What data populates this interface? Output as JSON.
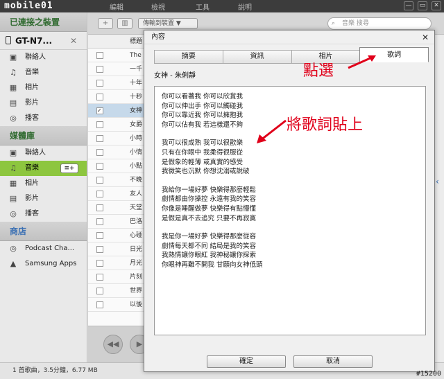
{
  "logo": "mobile01",
  "menu": [
    "編輯",
    "檢視",
    "工具",
    "說明"
  ],
  "window_controls": [
    "—",
    "▭",
    "✕"
  ],
  "sidebar": {
    "connected_header": "已連接之裝置",
    "device_name": "GT-N7...",
    "device_close": "✕",
    "device_items": [
      {
        "label": "聯絡人",
        "icon": "contacts-icon",
        "glyph": "▣"
      },
      {
        "label": "音樂",
        "icon": "music-icon",
        "glyph": "♫"
      },
      {
        "label": "相片",
        "icon": "photo-icon",
        "glyph": "▦"
      },
      {
        "label": "影片",
        "icon": "video-icon",
        "glyph": "▤"
      },
      {
        "label": "播客",
        "icon": "podcast-icon",
        "glyph": "◎"
      }
    ],
    "library_header": "媒體庫",
    "library_items": [
      {
        "label": "聯絡人",
        "icon": "contacts-icon",
        "glyph": "▣"
      },
      {
        "label": "音樂",
        "icon": "music-icon",
        "glyph": "♫"
      },
      {
        "label": "相片",
        "icon": "photo-icon",
        "glyph": "▦"
      },
      {
        "label": "影片",
        "icon": "video-icon",
        "glyph": "▤"
      },
      {
        "label": "播客",
        "icon": "podcast-icon",
        "glyph": "◎"
      }
    ],
    "add_button": "≡+",
    "shop_header": "商店",
    "shop_items": [
      {
        "label": "Podcast Cha...",
        "icon": "podcast-icon",
        "glyph": "◎"
      },
      {
        "label": "Samsung Apps",
        "icon": "apps-icon",
        "glyph": "▲"
      }
    ]
  },
  "status_bar": "1 首歌曲，3.5分鐘，6.77 MB",
  "toolbar": {
    "add": "+",
    "delete": "▥",
    "transfer_label": "傳輸到裝置 ▼",
    "search_placeholder": "音樂 搜尋"
  },
  "list": {
    "header": "標題",
    "rows": [
      "The I",
      "一千",
      "十年",
      "十秒",
      "女神",
      "女爵",
      "小時",
      "小情",
      "小點",
      "不晚",
      "友人",
      "天堂",
      "巴洛",
      "心碰",
      "日光",
      "月光",
      "片刻",
      "世界",
      "以後"
    ],
    "selected_index": 4
  },
  "dialog": {
    "title": "內容",
    "close": "✕",
    "tabs": [
      "摘要",
      "資訊",
      "相片",
      "歌詞"
    ],
    "active_tab": 3,
    "song_title": "女神 - 朱俐靜",
    "lyrics": [
      [
        "你可以看著我 你可以欣賞我",
        "你可以伸出手 你可以觸碰我",
        "你可以靠近我 你可以擁抱我",
        "你可以佔有我 若這樣還不夠"
      ],
      [
        "我可以很成熟 我可以很歡樂",
        "只有在你眼中 我柔得很服從",
        "是假象的輕薄 或真實的感受",
        "我微笑也沉默 你想沈溺或說破"
      ],
      [
        "我給你一場好夢 快樂得那麼輕鬆",
        "劇情都由你操控 永遠有我的笑容",
        "你像是睡醒做夢 快樂得有點懵懂",
        "是假是真不去追究 只要不再寂寞"
      ],
      [
        "我是你一場好夢 快樂得那麼從容",
        "劇情每天都不同 結局是我的笑容",
        "我熱情讓你眼紅 我神秘讓你探索",
        "你眼神再難不開我 甘願向女神低頭"
      ]
    ],
    "ok": "確定",
    "cancel": "取消"
  },
  "annotations": {
    "click": "點選",
    "paste": "將歌詞貼上"
  },
  "watermark": "#15200"
}
